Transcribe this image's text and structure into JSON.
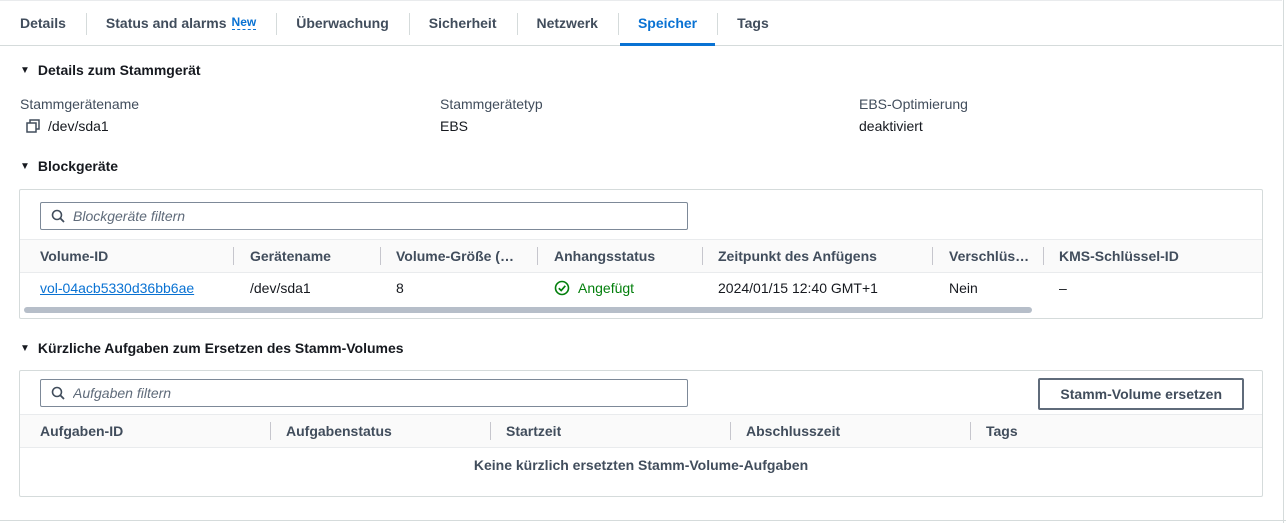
{
  "tabs": [
    {
      "label": "Details"
    },
    {
      "label": "Status and alarms",
      "badge": "New"
    },
    {
      "label": "Überwachung"
    },
    {
      "label": "Sicherheit"
    },
    {
      "label": "Netzwerk"
    },
    {
      "label": "Speicher",
      "active": true
    },
    {
      "label": "Tags"
    }
  ],
  "root_device": {
    "title": "Details zum Stammgerät",
    "name_label": "Stammgerätename",
    "name_value": "/dev/sda1",
    "type_label": "Stammgerätetyp",
    "type_value": "EBS",
    "ebs_label": "EBS-Optimierung",
    "ebs_value": "deaktiviert"
  },
  "block_devices": {
    "title": "Blockgeräte",
    "filter_placeholder": "Blockgeräte filtern",
    "columns": [
      "Volume-ID",
      "Gerätename",
      "Volume-Größe (…",
      "Anhangsstatus",
      "Zeitpunkt des Anfügens",
      "Verschlüs…",
      "KMS-Schlüssel-ID"
    ],
    "rows": [
      {
        "volume_id": "vol-04acb5330d36bb6ae",
        "device_name": "/dev/sda1",
        "size": "8",
        "status": "Angefügt",
        "attach_time": "2024/01/15 12:40 GMT+1",
        "encrypted": "Nein",
        "kms_key": "–"
      }
    ]
  },
  "replace_tasks": {
    "title": "Kürzliche Aufgaben zum Ersetzen des Stamm-Volumes",
    "filter_placeholder": "Aufgaben filtern",
    "button_label": "Stamm-Volume ersetzen",
    "columns": [
      "Aufgaben-ID",
      "Aufgabenstatus",
      "Startzeit",
      "Abschlusszeit",
      "Tags"
    ],
    "empty_text": "Keine kürzlich ersetzten Stamm-Volume-Aufgaben"
  },
  "colors": {
    "accent": "#0972d3",
    "success": "#037f0c",
    "border": "#d5dbdb"
  },
  "icons": [
    "caret-down-icon",
    "copy-icon",
    "search-icon",
    "status-success-icon"
  ]
}
